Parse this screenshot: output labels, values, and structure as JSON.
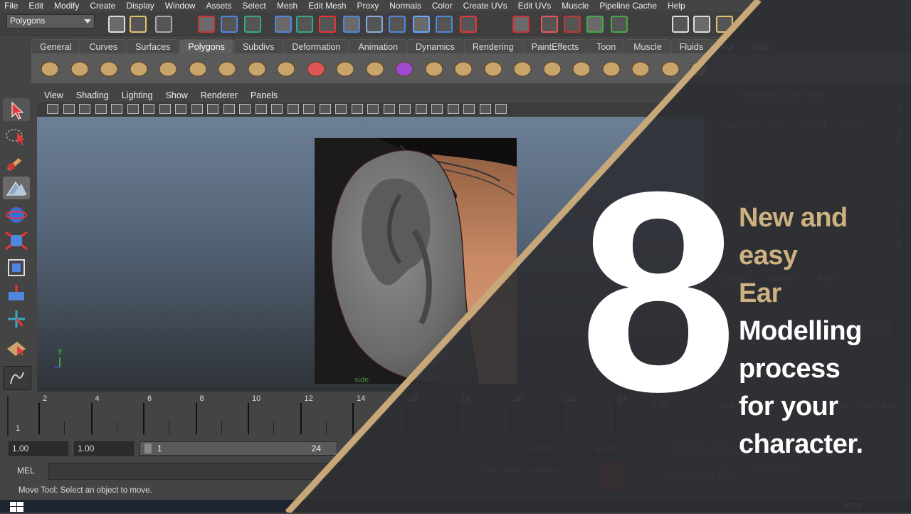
{
  "menu": [
    "File",
    "Edit",
    "Modify",
    "Create",
    "Display",
    "Window",
    "Assets",
    "Select",
    "Mesh",
    "Edit Mesh",
    "Proxy",
    "Normals",
    "Color",
    "Create UVs",
    "Edit UVs",
    "Muscle",
    "Pipeline Cache",
    "Help"
  ],
  "status_line": {
    "mode": "Polygons"
  },
  "shelf_tabs": [
    "General",
    "Curves",
    "Surfaces",
    "Polygons",
    "Subdivs",
    "Deformation",
    "Animation",
    "Dynamics",
    "Rendering",
    "PaintEffects",
    "Toon",
    "Muscle",
    "Fluids",
    "Fur",
    "Hair"
  ],
  "active_shelf_tab": "Polygons",
  "viewport": {
    "menu": [
      "View",
      "Shading",
      "Lighting",
      "Show",
      "Renderer",
      "Panels"
    ],
    "camera_label": "side",
    "axis_y": "y"
  },
  "right_panel": {
    "title": "Channel Box / Layer Editor",
    "menu": [
      "Channels",
      "Edit",
      "Object",
      "Show"
    ],
    "layer_tabs": [
      "Display",
      "Render",
      "Anim"
    ],
    "side_tabs": [
      "Attribute Editor",
      "Channel Box / Layer Editor"
    ]
  },
  "time_slider": {
    "ticks": [
      "2",
      "4",
      "6",
      "8",
      "10",
      "12",
      "14",
      "16",
      "18",
      "20",
      "22",
      "24"
    ],
    "current_frame": "1",
    "current_time_field": "1.00"
  },
  "range_slider": {
    "start": "1.00",
    "playback_start": "1.00",
    "inner_start": "1",
    "inner_end": "24",
    "playback_end": "24.00",
    "end": "48.00",
    "anim_layer": "No Anim Layer",
    "character_set": "No Character Set"
  },
  "command_line": {
    "label": "MEL",
    "feedback": "Undo: select -r pPlane2"
  },
  "help_line": "Move Tool: Select an object to move.",
  "recorder": {
    "time": "00:41:56",
    "resolution": "1024 × 768"
  },
  "watermark": {
    "line1": "Activate Windows",
    "line2": "Go to Settings"
  },
  "taskbar": {
    "clock": "20:04"
  },
  "overlay": {
    "number": "8",
    "line1": "New and easy",
    "line2_accent": "Ear",
    "line2_rest": " Modelling",
    "line3": "process",
    "line4": "for your",
    "line5": "character."
  },
  "colors": {
    "accent_gold": "#cdb180",
    "diagonal_stripe": "#c8a878",
    "dark_overlay": "#2e2f33"
  }
}
